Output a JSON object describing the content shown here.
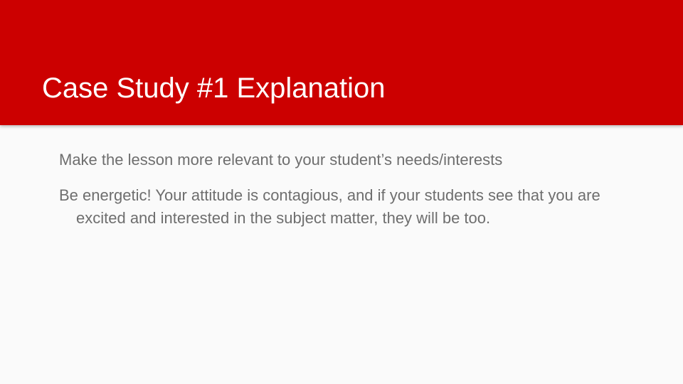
{
  "slide": {
    "title": "Case Study #1 Explanation",
    "bullets": [
      "Make the lesson more relevant to your student’s needs/interests",
      "Be energetic! Your attitude is contagious, and if your students see that you are excited and interested in the subject matter, they will be too."
    ]
  },
  "colors": {
    "title_bar": "#cc0000",
    "title_text": "#ffffff",
    "background": "#fafafa",
    "body_text": "#6e6e6e"
  }
}
